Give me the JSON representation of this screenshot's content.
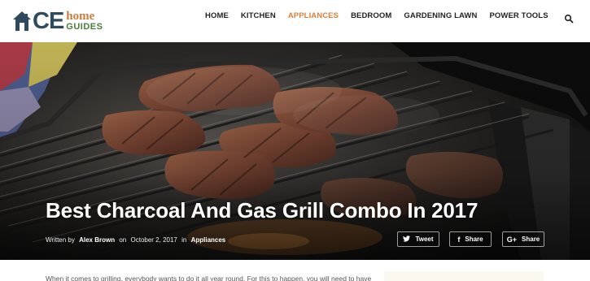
{
  "logo": {
    "ce": "CE",
    "home": "home",
    "guides": "GUIDES"
  },
  "nav": {
    "items": [
      {
        "label": "HOME"
      },
      {
        "label": "KITCHEN"
      },
      {
        "label": "APPLIANCES"
      },
      {
        "label": "BEDROOM"
      },
      {
        "label": "GARDENING LAWN"
      },
      {
        "label": "POWER TOOLS"
      }
    ],
    "active_color": "#d87f3c"
  },
  "hero": {
    "title": "Best Charcoal And Gas Grill Combo In 2017",
    "meta": {
      "written_by": "Written by",
      "author": "Alex Brown",
      "on": "on",
      "date": "October 2, 2017",
      "in": "in",
      "category": "Appliances"
    },
    "share": {
      "tweet": "Tweet",
      "facebook": "Share",
      "gplus": "Share"
    }
  },
  "article": {
    "first_line": "When it comes to grilling, everybody wants to do it all year round. For this to happen, you will need to have"
  }
}
